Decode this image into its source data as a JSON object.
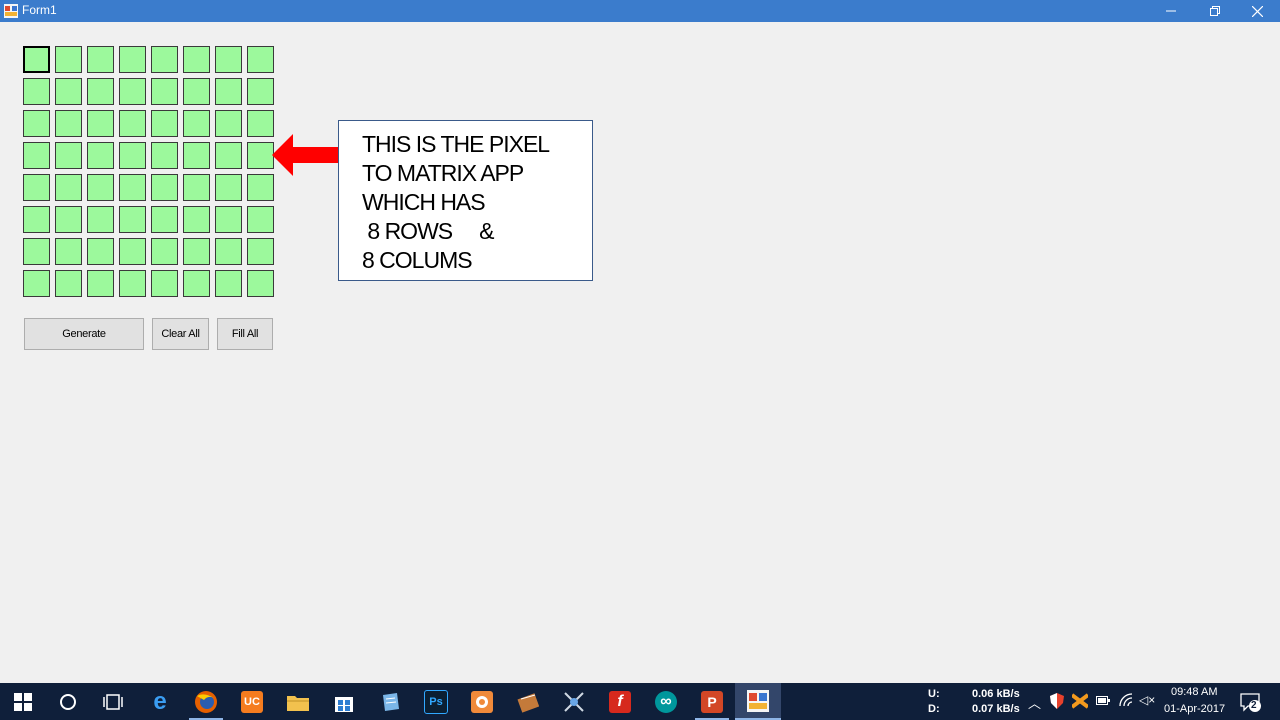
{
  "window": {
    "title": "Form1",
    "minimize_icon": "minimize-icon",
    "maximize_icon": "restore-icon",
    "close_icon": "close-icon"
  },
  "matrix": {
    "rows": 8,
    "cols": 8,
    "cell_color": "#9cf99c",
    "focused_cell": [
      0,
      0
    ]
  },
  "buttons": {
    "generate": "Generate",
    "clear_all": "Clear All",
    "fill_all": "Fill All"
  },
  "annotation": {
    "lines": [
      "THIS IS THE PIXEL",
      "TO MATRIX APP",
      "WHICH HAS",
      " 8 ROWS     &",
      "8 COLUMS"
    ],
    "arrow_color": "#ff0000"
  },
  "taskbar": {
    "apps": [
      {
        "name": "start",
        "icon": "windows-start-icon"
      },
      {
        "name": "search",
        "icon": "cortana-icon"
      },
      {
        "name": "task-view",
        "icon": "task-view-icon"
      },
      {
        "name": "edge",
        "icon": "edge-icon",
        "label": "e"
      },
      {
        "name": "firefox",
        "icon": "firefox-icon"
      },
      {
        "name": "uc-browser",
        "icon": "uc-browser-icon"
      },
      {
        "name": "file-explorer",
        "icon": "folder-icon"
      },
      {
        "name": "store",
        "icon": "store-icon"
      },
      {
        "name": "notepad",
        "icon": "notepad-icon"
      },
      {
        "name": "photoshop",
        "icon": "photoshop-icon",
        "label": "Ps"
      },
      {
        "name": "orange-app",
        "icon": "orange-app-icon"
      },
      {
        "name": "media-app",
        "icon": "media-app-icon"
      },
      {
        "name": "network-app",
        "icon": "network-app-icon"
      },
      {
        "name": "flash",
        "icon": "flash-icon",
        "label": "f"
      },
      {
        "name": "arduino",
        "icon": "arduino-icon",
        "label": "∞"
      },
      {
        "name": "powerpoint",
        "icon": "powerpoint-icon",
        "label": "P"
      },
      {
        "name": "form-app",
        "icon": "form-app-icon"
      }
    ],
    "network": {
      "upload_label": "U:",
      "download_label": "D:",
      "upload": "0.06 kB/s",
      "download": "0.07 kB/s"
    },
    "clock": {
      "time": "09:48 AM",
      "date": "01-Apr-2017"
    },
    "notifications": "2"
  }
}
